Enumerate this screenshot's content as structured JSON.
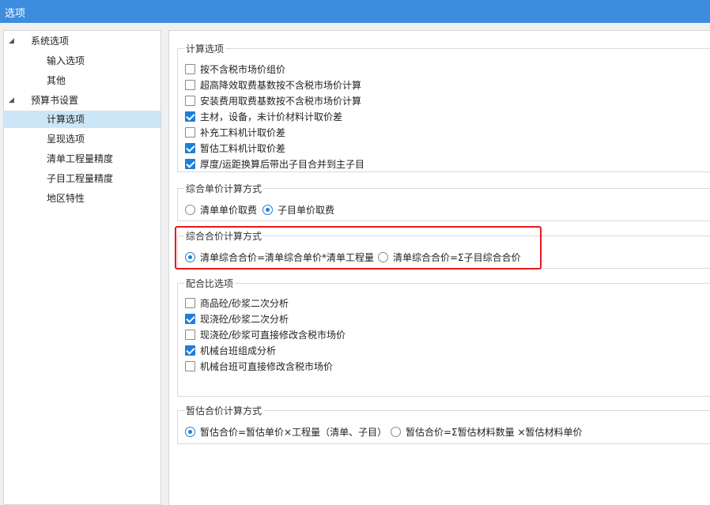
{
  "window": {
    "title": "选项"
  },
  "tree": {
    "items": [
      {
        "label": "系统选项"
      },
      {
        "label": "输入选项"
      },
      {
        "label": "其他"
      },
      {
        "label": "预算书设置"
      },
      {
        "label": "计算选项"
      },
      {
        "label": "呈现选项"
      },
      {
        "label": "清单工程量精度"
      },
      {
        "label": "子目工程量精度"
      },
      {
        "label": "地区特性"
      }
    ],
    "expand_glyph": "◢",
    "selected_index": 4
  },
  "groups": {
    "calc": {
      "title": "计算选项",
      "options": [
        {
          "label": "按不含税市场价组价",
          "checked": false
        },
        {
          "label": "超高降效取费基数按不含税市场价计算",
          "checked": false
        },
        {
          "label": "安装费用取费基数按不含税市场价计算",
          "checked": false
        },
        {
          "label": "主材，设备，未计价材料计取价差",
          "checked": true
        },
        {
          "label": "补充工料机计取价差",
          "checked": false
        },
        {
          "label": "暂估工料机计取价差",
          "checked": true
        },
        {
          "label": "厚度/运距换算后带出子目合并到主子目",
          "checked": true
        }
      ]
    },
    "unit_price": {
      "title": "综合单价计算方式",
      "options": [
        {
          "label": "清单单价取费",
          "selected": false
        },
        {
          "label": "子目单价取费",
          "selected": true
        }
      ]
    },
    "total_price": {
      "title": "综合合价计算方式",
      "options": [
        {
          "label": "清单综合合价=清单综合单价*清单工程量",
          "selected": true
        },
        {
          "label": "清单综合合价=Σ子目综合合价",
          "selected": false
        }
      ]
    },
    "mix": {
      "title": "配合比选项",
      "options": [
        {
          "label": "商品砼/砂浆二次分析",
          "checked": false
        },
        {
          "label": "现浇砼/砂浆二次分析",
          "checked": true
        },
        {
          "label": "现浇砼/砂浆可直接修改含税市场价",
          "checked": false
        },
        {
          "label": "机械台班组成分析",
          "checked": true
        },
        {
          "label": "机械台班可直接修改含税市场价",
          "checked": false
        }
      ]
    },
    "estimate": {
      "title": "暂估合价计算方式",
      "options": [
        {
          "label": "暂估合价=暂估单价×工程量（清单、子目）",
          "selected": true
        },
        {
          "label": "暂估合价=Σ暂估材料数量 ×暂估材料单价",
          "selected": false
        }
      ]
    }
  },
  "colors": {
    "titlebar": "#3c8dde",
    "accent": "#1e7fd8",
    "highlight": "#e8191c",
    "selected_row": "#cde6f7"
  }
}
